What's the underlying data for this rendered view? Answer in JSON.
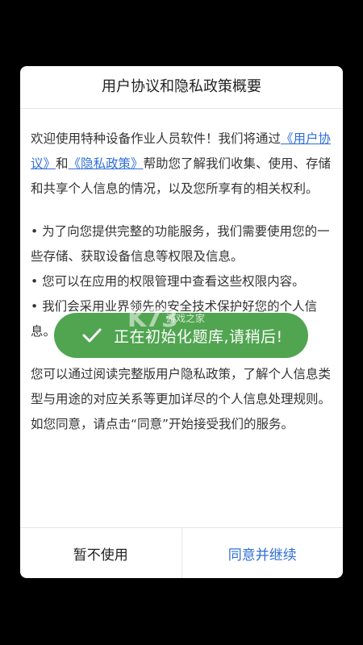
{
  "dialog": {
    "title": "用户协议和隐私政策概要",
    "intro_prefix": "欢迎使用特种设备作业人员软件！我们将通过",
    "user_agreement_link": "《用户协议》",
    "and": "和",
    "privacy_policy_link": "《隐私政策》",
    "intro_suffix": "帮助您了解我们收集、使用、存储和共享个人信息的情况，以及您所享有的相关权利。",
    "bullets": [
      "• 为了向您提供完整的功能服务，我们需要使用您的一些存储、获取设备信息等权限及信息。",
      "• 您可以在应用的权限管理中查看这些权限内容。",
      "• 我们会采用业界领先的安全技术保护好您的个人信息。"
    ],
    "full_policy_text": "您可以通过阅读完整版用户隐私政策，了解个人信息类型与用途的对应关系等更加详尽的个人信息处理规则。",
    "consent_text": "如您同意，请点击“同意”开始接受我们的服务。",
    "decline_button": "暂不使用",
    "accept_button": "同意并继续"
  },
  "toast": {
    "text": "正在初始化题库,请稍后!",
    "icon": "checkmark-icon",
    "color": "#48a048"
  },
  "watermark": {
    "logo": "K73",
    "subtitle": "游戏之家"
  },
  "colors": {
    "link": "#2f6fd6",
    "background": "#000000"
  }
}
